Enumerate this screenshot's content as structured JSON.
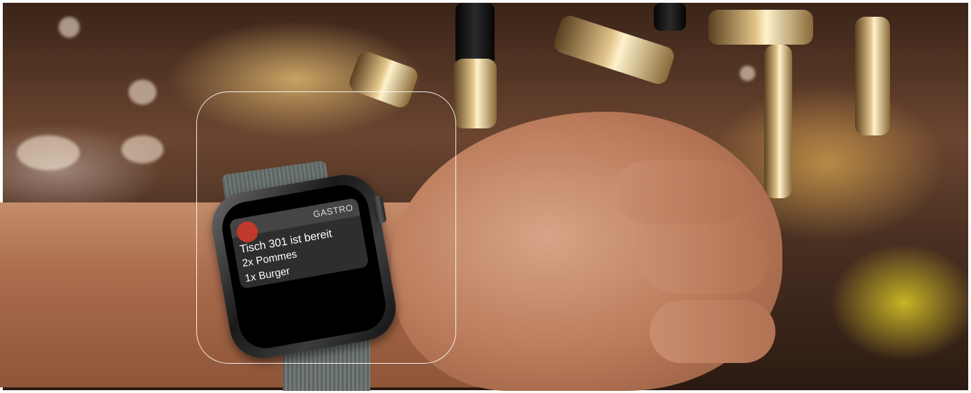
{
  "notification": {
    "app_name": "GASTRO",
    "app_icon_color": "#c0392b",
    "lines": [
      "Tisch 301 ist bereit",
      "2x Pommes",
      "1x Burger"
    ]
  },
  "colors": {
    "frame": "#ffffff",
    "tap_gold": "#e2c48a",
    "screen": "#000000"
  }
}
